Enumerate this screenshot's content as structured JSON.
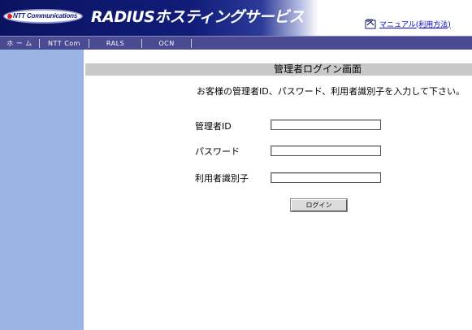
{
  "header": {
    "logo_text": "NTT Communications",
    "service_title": "RADIUSホスティングサービス",
    "manual_link": "マニュアル(利用方法)",
    "go_icon_text": "GO"
  },
  "nav": {
    "items": [
      "ホ ー ム",
      "NTT Com",
      "RALS",
      "OCN"
    ]
  },
  "main": {
    "page_title": "管理者ログイン画面",
    "instruction": "お客様の管理者ID、パスワード、利用者識別子を入力して下さい。",
    "fields": [
      {
        "label": "管理者ID",
        "value": ""
      },
      {
        "label": "パスワード",
        "value": ""
      },
      {
        "label": "利用者識別子",
        "value": ""
      }
    ],
    "login_button": "ログイン"
  },
  "colors": {
    "brand_navy": "#0b1360",
    "nav_bg": "#4a4a92",
    "sidebar": "#9ab4e4",
    "title_bar": "#c8c8c8",
    "link": "#0000cc"
  }
}
